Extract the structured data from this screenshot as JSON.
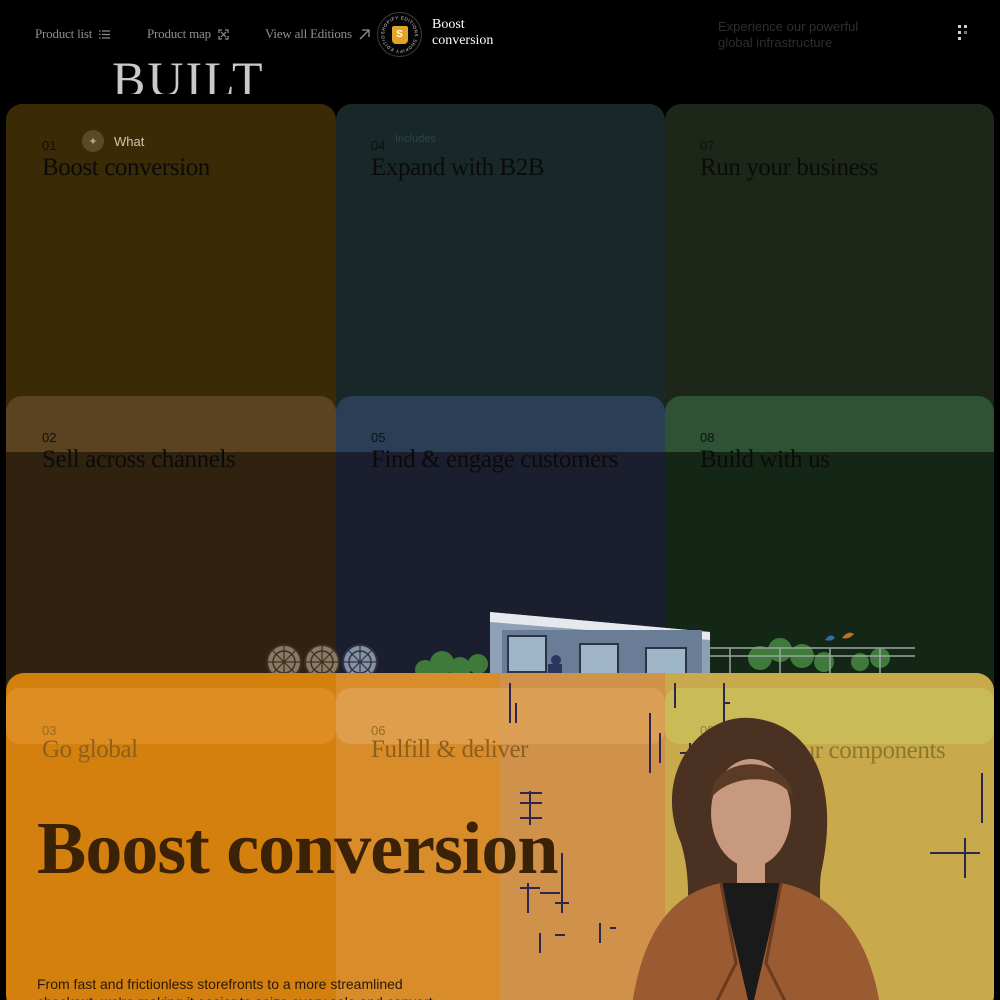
{
  "nav": {
    "links": [
      {
        "label": "Product list",
        "icon": "list-icon"
      },
      {
        "label": "Product map",
        "icon": "expand-icon"
      },
      {
        "label": "View all Editions",
        "icon": "arrow-up-right-icon"
      }
    ],
    "edition": {
      "badge_ring_text": "SHOPIFY EDITIONS SHOPIFY EDITIONS",
      "title": "Boost conversion"
    },
    "background_heading": "BUILT",
    "background_tagline": "Experience our powerful global infrastructure",
    "menu_icon": "grid-dots-icon"
  },
  "tiles": [
    {
      "num": "01",
      "title": "Boost conversion",
      "color": "#3a2a06"
    },
    {
      "num": "02",
      "title": "Sell across channels",
      "color": "#312210"
    },
    {
      "num": "03",
      "title": "Go global",
      "color": "#36230c"
    },
    {
      "num": "04",
      "title": "Expand with B2B",
      "color": "#182728"
    },
    {
      "num": "05",
      "title": "Find & engage customers",
      "color": "#1a1e2e"
    },
    {
      "num": "06",
      "title": "Fulfill & deliver",
      "color": "#1c1e2a"
    },
    {
      "num": "07",
      "title": "Run your business",
      "color": "#1c2719"
    },
    {
      "num": "08",
      "title": "Build with us",
      "color": "#142716"
    },
    {
      "num": "09",
      "title": "Choose your components",
      "color": "#1a2a1a"
    }
  ],
  "ghost": {
    "what_label": "What",
    "includes_label": "Includes"
  },
  "hero": {
    "title": "Boost conversion",
    "description": "From fast and frictionless storefronts to a more streamlined checkout, we're making it easier to seize every sale and convert",
    "color": "#d4800f"
  }
}
